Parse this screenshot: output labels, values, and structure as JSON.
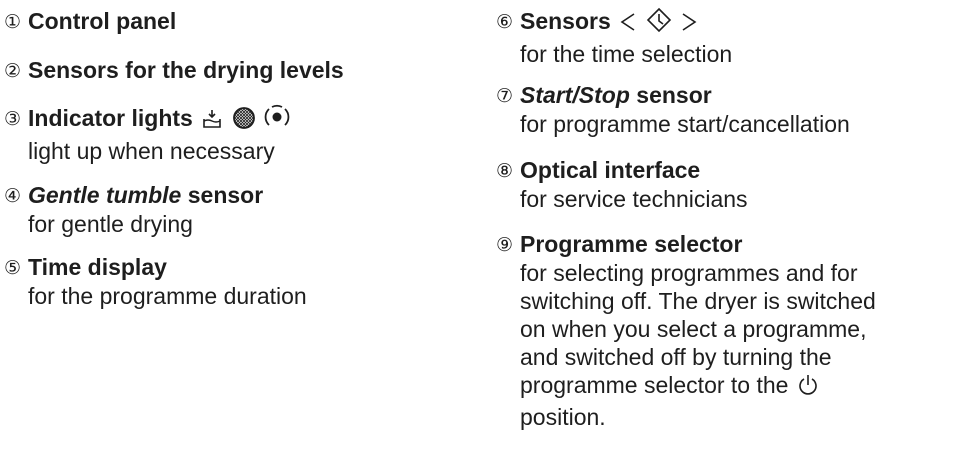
{
  "left": {
    "items": [
      {
        "num": "①",
        "title": "Control panel",
        "desc": ""
      },
      {
        "num": "②",
        "title": "Sensors for the drying levels",
        "desc": ""
      },
      {
        "num": "③",
        "title": "Indicator lights",
        "desc": "light up when necessary",
        "icons": [
          "condenser-icon",
          "filter-icon",
          "container-icon"
        ]
      },
      {
        "num": "④",
        "title_italic": "Gentle tumble",
        "title_rest": " sensor",
        "desc": "for gentle drying"
      },
      {
        "num": "⑤",
        "title": "Time display",
        "desc": "for the programme duration"
      }
    ]
  },
  "right": {
    "items": [
      {
        "num": "⑥",
        "title": "Sensors",
        "desc": "for the time selection",
        "icons": [
          "less-than-icon",
          "time-diamond-icon",
          "greater-than-icon"
        ]
      },
      {
        "num": "⑦",
        "title_italic": "Start/Stop",
        "title_rest": " sensor",
        "desc": "for programme start/cancellation"
      },
      {
        "num": "⑧",
        "title": "Optical interface",
        "desc": "for service technicians"
      },
      {
        "num": "⑨",
        "title": "Programme selector",
        "desc_lines": [
          "for selecting programmes and for",
          "switching off. The dryer is switched",
          "on when you select a programme,",
          "and switched off by turning the",
          "programme selector to the",
          "position."
        ],
        "icons": [
          "power-icon"
        ]
      }
    ]
  }
}
